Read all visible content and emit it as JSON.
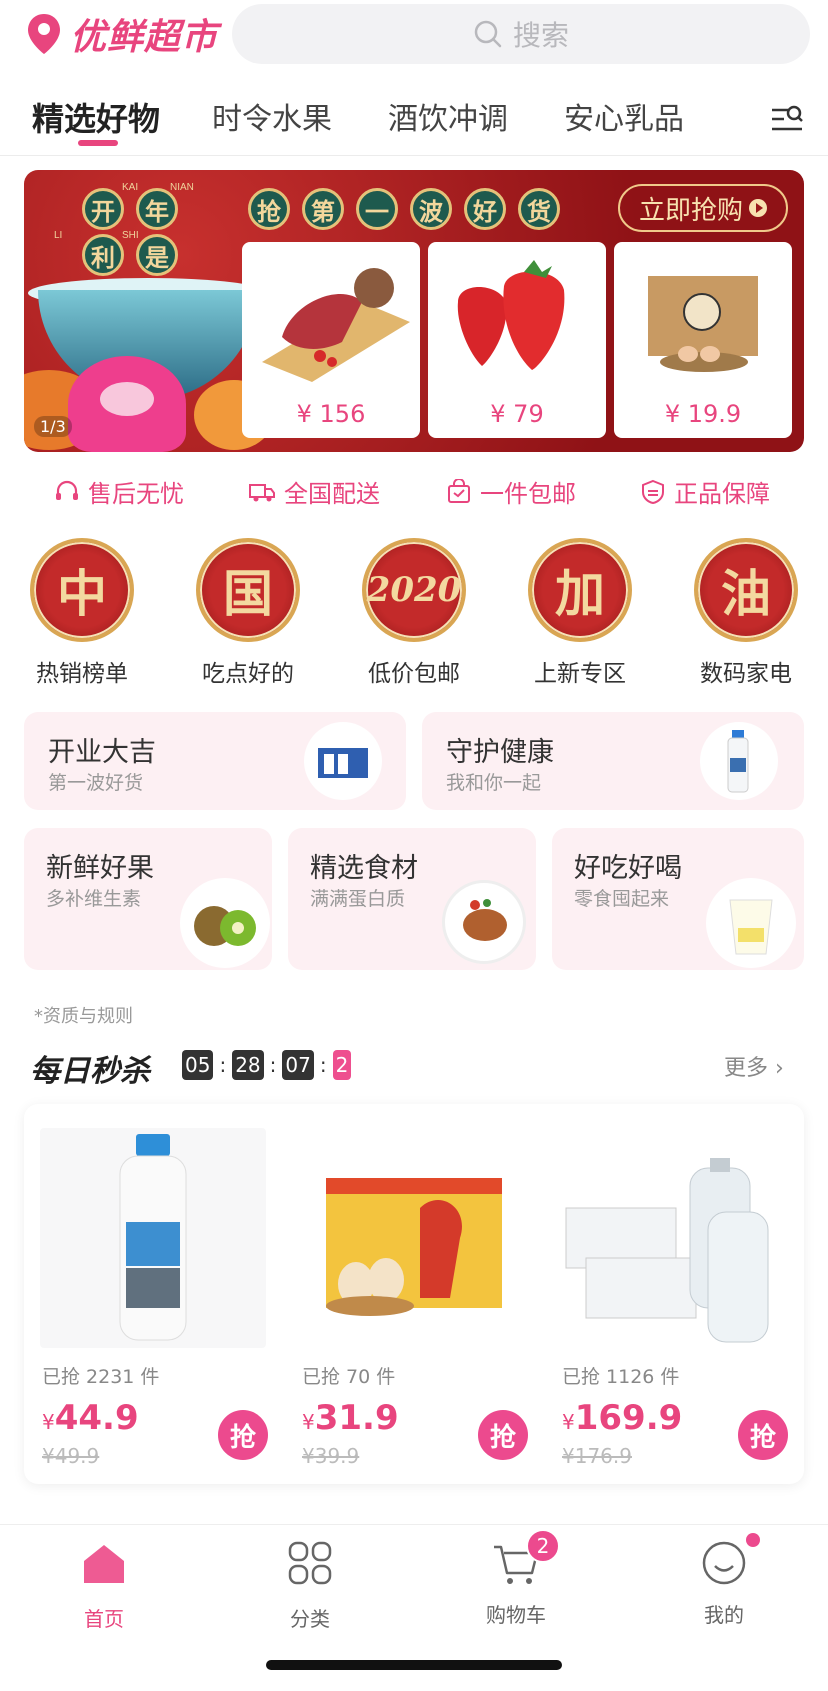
{
  "header": {
    "app_name": "优鲜超市",
    "search_placeholder": "搜索"
  },
  "tabs": [
    {
      "label": "精选好物",
      "active": true
    },
    {
      "label": "时令水果"
    },
    {
      "label": "酒饮冲调"
    },
    {
      "label": "安心乳品"
    }
  ],
  "banner": {
    "slogan_chars": [
      "开",
      "年",
      "利",
      "是"
    ],
    "pinyin": [
      "KAI",
      "NIAN",
      "LI",
      "SHI"
    ],
    "headline_chars": [
      "抢",
      "第",
      "一",
      "波",
      "好",
      "货"
    ],
    "buy_now_label": "立即抢购",
    "products": [
      {
        "name": "beef-cut",
        "price": "¥ 156"
      },
      {
        "name": "strawberries",
        "price": "¥ 79"
      },
      {
        "name": "egg-box",
        "price": "¥ 19.9"
      }
    ],
    "pager": "1/3"
  },
  "guarantees": [
    {
      "label": "售后无忧",
      "icon": "headset-icon"
    },
    {
      "label": "全国配送",
      "icon": "truck-icon"
    },
    {
      "label": "一件包邮",
      "icon": "bag-icon"
    },
    {
      "label": "正品保障",
      "icon": "shield-icon"
    }
  ],
  "categories": [
    {
      "glyph": "中",
      "label": "热销榜单"
    },
    {
      "glyph": "国",
      "label": "吃点好的"
    },
    {
      "glyph": "2020",
      "label": "低价包邮"
    },
    {
      "glyph": "加",
      "label": "上新专区"
    },
    {
      "glyph": "油",
      "label": "数码家电"
    }
  ],
  "promos": [
    {
      "title": "开业大吉",
      "sub": "第一波好货"
    },
    {
      "title": "守护健康",
      "sub": "我和你一起"
    },
    {
      "title": "新鲜好果",
      "sub": "多补维生素"
    },
    {
      "title": "精选食材",
      "sub": "满满蛋白质"
    },
    {
      "title": "好吃好喝",
      "sub": "零食囤起来"
    }
  ],
  "rules_link": "*资质与规则",
  "flash_sale": {
    "title": "每日秒杀",
    "timer": [
      "05",
      "28",
      "07",
      "2"
    ],
    "more_label": "更多 ›",
    "items": [
      {
        "sold": "已抢 2231 件",
        "currency": "¥",
        "price": "44.9",
        "original": "¥49.9",
        "grab": "抢"
      },
      {
        "sold": "已抢 70 件",
        "currency": "¥",
        "price": "31.9",
        "original": "¥39.9",
        "grab": "抢"
      },
      {
        "sold": "已抢 1126 件",
        "currency": "¥",
        "price": "169.9",
        "original": "¥176.9",
        "grab": "抢"
      }
    ]
  },
  "bottom_nav": [
    {
      "label": "首页",
      "active": true
    },
    {
      "label": "分类"
    },
    {
      "label": "购物车",
      "badge": "2"
    },
    {
      "label": "我的"
    }
  ],
  "colors": {
    "accent": "#e8457e",
    "banner_red": "#9a1a1c",
    "card_pink": "#fdf0f3"
  }
}
